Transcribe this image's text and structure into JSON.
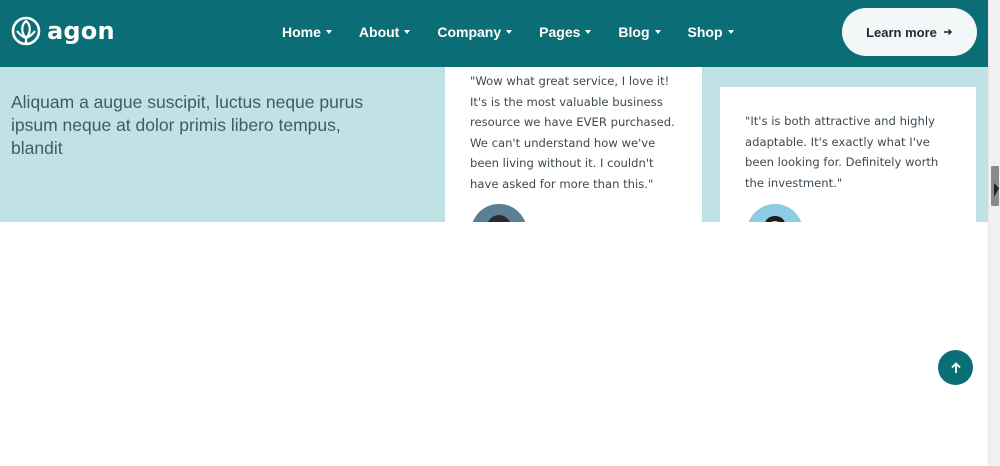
{
  "header": {
    "brand": "agon",
    "logo_icon": "leaf-logo-icon",
    "nav": [
      {
        "label": "Home"
      },
      {
        "label": "About"
      },
      {
        "label": "Company"
      },
      {
        "label": "Pages"
      },
      {
        "label": "Blog"
      },
      {
        "label": "Shop"
      }
    ],
    "cta_label": "Learn more"
  },
  "hero": {
    "text": "Aliquam a augue suscipit, luctus neque purus ipsum neque at dolor primis libero tempus, blandit"
  },
  "testimonials": [
    {
      "quote": "\"Wow what great service, I love it! It's is the most valuable business resource we have EVER purchased. We can't understand how we've been living without it. I couldn't have asked for more than this.\""
    },
    {
      "quote": "\"It's is both attractive and highly adaptable. It's exactly what I've been looking for. Definitely worth the investment.\""
    }
  ],
  "colors": {
    "header_bg": "#0b6e76",
    "band_bg": "#c0e2e7",
    "accent": "#0b6e76"
  },
  "icons": {
    "back_to_top": "arrow-up-icon",
    "cta_arrow": "arrow-right-icon",
    "nav_caret": "chevron-down-icon"
  }
}
